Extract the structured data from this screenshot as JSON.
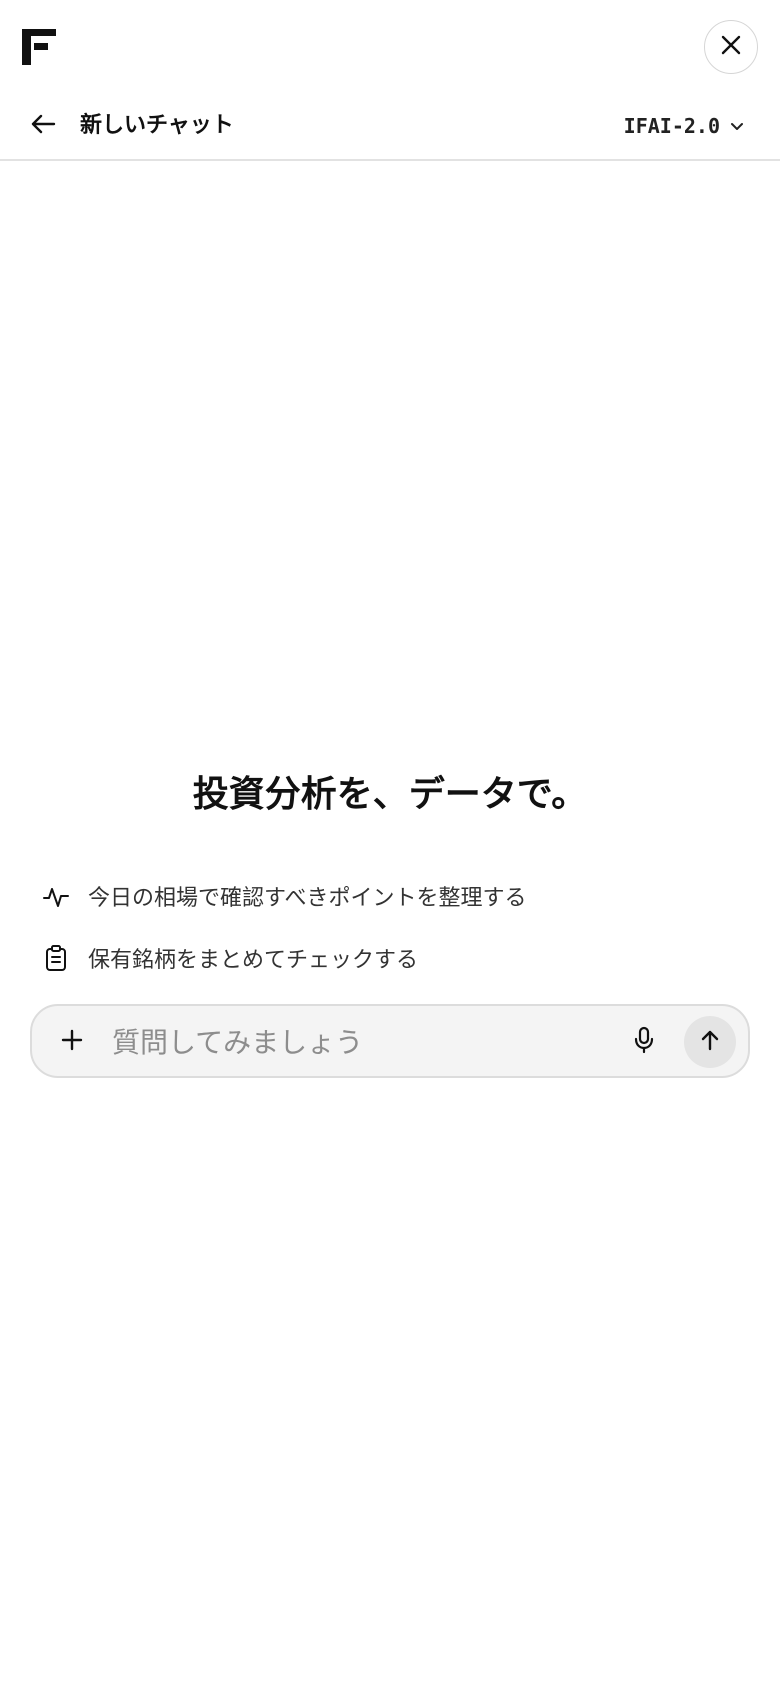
{
  "header": {
    "logo_icon": "brand-f-logo",
    "close_icon": "close-icon"
  },
  "chat": {
    "back_icon": "arrow-left-icon",
    "title": "新しいチャット",
    "model": "IFAI-2.0",
    "model_icon": "chevron-down-icon"
  },
  "hero": {
    "headline": "投資分析を、データで。"
  },
  "suggestions": [
    {
      "icon": "activity-icon",
      "label": "今日の相場で確認すべきポイントを整理する"
    },
    {
      "icon": "clipboard-icon",
      "label": "保有銘柄をまとめてチェックする"
    }
  ],
  "composer": {
    "placeholder": "質問してみましょう",
    "add_icon": "plus-icon",
    "mic_icon": "microphone-icon",
    "send_icon": "arrow-up-icon"
  },
  "colors": {
    "background": "#ffffff",
    "composer_bg": "#f4f4f4",
    "send_button_bg": "#e4e4e4",
    "text": "#111111"
  }
}
